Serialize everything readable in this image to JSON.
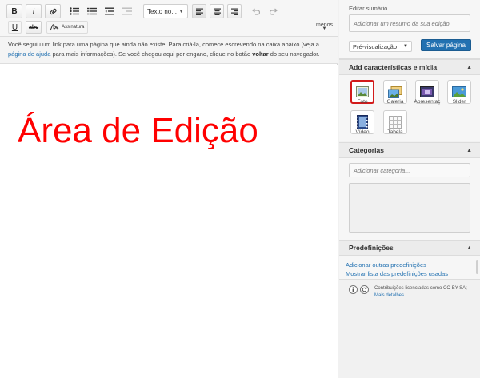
{
  "toolbar": {
    "bold_label": "B",
    "italic_label": "i",
    "format_select": "Texto no...",
    "underline_label": "U",
    "strike_label": "abc",
    "signature_label": "Assinatura",
    "less_label": "menos"
  },
  "notice": {
    "text_before": "Você seguiu um link para uma página que ainda não existe. Para criá-la, comece escrevendo na caixa abaixo (veja a",
    "help_link": "página de ajuda",
    "text_middle": " para mais informações). Se você chegou aqui por engano, clique no botão ",
    "back_word": "voltar",
    "text_after": " do seu navegador."
  },
  "editor": {
    "overlay_label": "Área de Edição"
  },
  "summary": {
    "label": "Editar sumário",
    "placeholder": "Adicionar um resumo da sua edição",
    "preview_label": "Pré-visualização",
    "save_label": "Salvar página"
  },
  "media": {
    "title": "Add características e mídia",
    "items": [
      {
        "label": "Foto"
      },
      {
        "label": "Galeria"
      },
      {
        "label": "Apresentaç"
      },
      {
        "label": "Slider"
      },
      {
        "label": "Vídeo"
      },
      {
        "label": "Tabela"
      }
    ]
  },
  "categories": {
    "title": "Categorias",
    "placeholder": "Adicionar categoria..."
  },
  "presets": {
    "title": "Predefinições",
    "link_add": "Adicionar outras predefinições",
    "link_list": "Mostrar lista das predefinições usadas"
  },
  "license": {
    "text": "Contribuições licenciadas como CC-BY-SA;",
    "link": "Mais detalhes."
  },
  "colors": {
    "accent": "#2271b1",
    "overlay": "#ff0000",
    "selected_border": "#d21b1b"
  }
}
